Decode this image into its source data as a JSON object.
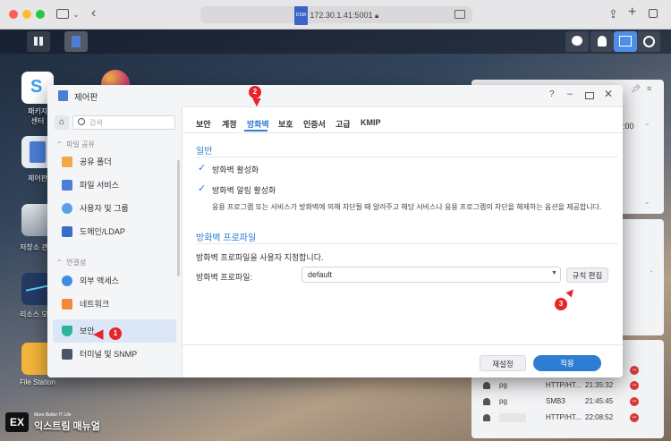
{
  "browser": {
    "url": "172.30.1.41:5001",
    "url_badge": "DSM"
  },
  "desktop": {
    "icons": [
      {
        "label": "패키지\n센터"
      },
      {
        "label": "제어판"
      },
      {
        "label": "저장소 관리"
      },
      {
        "label": "리소스 모니"
      },
      {
        "label": "File Station"
      }
    ],
    "package_label_l1": "패키지",
    "package_label_l2": "센터",
    "control_label": "제어판",
    "storage_label": "저장소 관",
    "resource_label": "리소스 모",
    "filestation_label": "File Station"
  },
  "widgets": {
    "time_text": "6:00",
    "conn_rows": [
      {
        "user": "pg",
        "proto": "HTTP/HT...",
        "time": "21:35:32"
      },
      {
        "user": "pg",
        "proto": "SMB3",
        "time": "21:45:45"
      },
      {
        "user": "",
        "proto": "HTTP/HT...",
        "time": "22:08:52"
      }
    ]
  },
  "window": {
    "title": "제어판",
    "search_placeholder": "검색",
    "sidebar": {
      "section_file_share": "파일 공유",
      "section_connectivity": "연결성",
      "items": [
        {
          "label": "공유 폴더"
        },
        {
          "label": "파일 서비스"
        },
        {
          "label": "사용자 및 그룹"
        },
        {
          "label": "도메인/LDAP"
        },
        {
          "label": "외부 액세스"
        },
        {
          "label": "네트워크"
        },
        {
          "label": "보안"
        },
        {
          "label": "터미널 및 SNMP"
        }
      ]
    },
    "tabs": [
      "보안",
      "계정",
      "방화벽",
      "보호",
      "인증서",
      "고급",
      "KMIP"
    ],
    "general_title": "일반",
    "enable_firewall": "방화벽 활성화",
    "enable_firewall_notify": "방화벽 알림 활성화",
    "notify_desc": "응용 프로그램 또는 서비스가 방화벽에 의해 차단될 때 알려주고 해당 서비스나 응용 프로그램의 차단을 해제하는 옵션을 제공합니다.",
    "profile_title": "방화벽 프로파일",
    "profile_desc": "방화벽 프로파일을 사용자 지정합니다.",
    "profile_label": "방화벽 프로파일:",
    "profile_value": "default",
    "edit_rules": "규칙 편집",
    "reset": "재설정",
    "apply": "적용"
  },
  "annotations": {
    "n1": "1",
    "n2": "2",
    "n3": "3"
  },
  "watermark": {
    "logo": "EX",
    "tagline": "More Better IT Life",
    "name": "익스트림 매뉴얼"
  },
  "colors": {
    "accent": "#2d7dd2",
    "annotation_red": "#e8232a",
    "selected_bg": "#dbe7f7"
  }
}
